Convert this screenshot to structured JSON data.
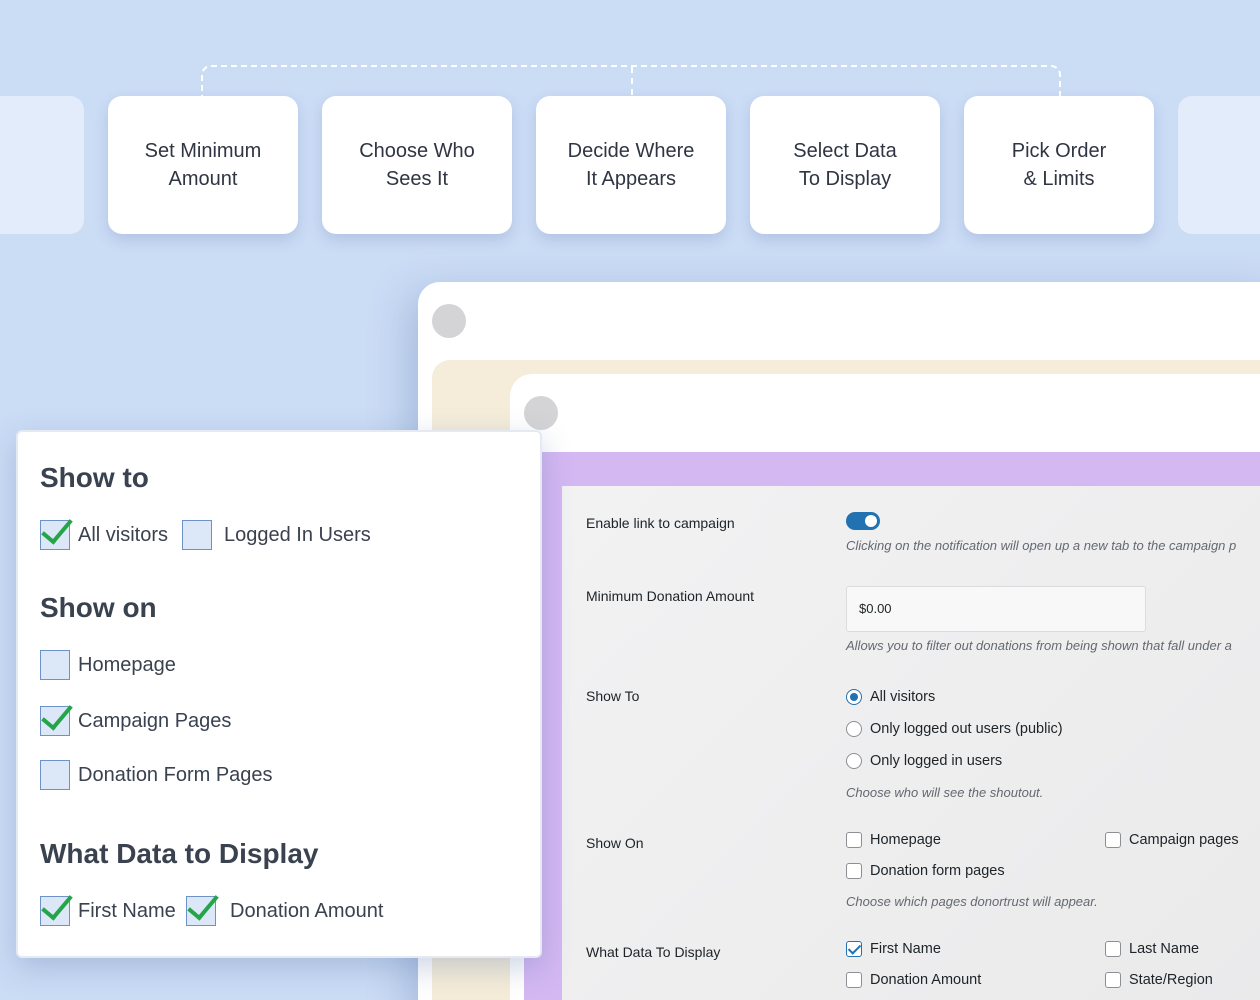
{
  "steps": [
    {
      "label": "Set Minimum\nAmount"
    },
    {
      "label": "Choose Who\nSees It"
    },
    {
      "label": "Decide Where\nIt Appears"
    },
    {
      "label": "Select Data\nTo Display"
    },
    {
      "label": "Pick Order\n& Limits"
    }
  ],
  "settings": {
    "enable_link": {
      "label": "Enable link to campaign",
      "enabled": true,
      "help": "Clicking on the notification will open up a new tab to the campaign p"
    },
    "min_donation": {
      "label": "Minimum Donation Amount",
      "value": "$0.00",
      "help": "Allows you to filter out donations from being shown that fall under a"
    },
    "show_to": {
      "label": "Show To",
      "options": [
        "All visitors",
        "Only logged out users (public)",
        "Only logged in users"
      ],
      "selected": "All visitors",
      "help": "Choose who will see the shoutout."
    },
    "show_on": {
      "label": "Show On",
      "options": [
        "Homepage",
        "Campaign pages",
        "Donation form pages"
      ],
      "help": "Choose which pages donortrust will appear."
    },
    "data_display": {
      "label": "What Data To Display",
      "options": [
        "First Name",
        "Last Name",
        "Donation Amount",
        "State/Region"
      ],
      "checked": [
        "First Name"
      ]
    }
  },
  "panel": {
    "show_to": {
      "heading": "Show to",
      "items": [
        "All visitors",
        "Logged In Users"
      ],
      "checked": [
        "All visitors"
      ]
    },
    "show_on": {
      "heading": "Show on",
      "items": [
        "Homepage",
        "Campaign Pages",
        "Donation Form Pages"
      ],
      "checked": [
        "Campaign Pages"
      ]
    },
    "data": {
      "heading": "What Data to Display",
      "items": [
        "First Name",
        "Donation Amount"
      ],
      "checked": [
        "First Name",
        "Donation Amount"
      ]
    }
  },
  "colors": {
    "background": "#cbdcf5",
    "accent": "#2271b1",
    "check_green": "#23a548",
    "purple_frame": "#d4b8f2"
  }
}
